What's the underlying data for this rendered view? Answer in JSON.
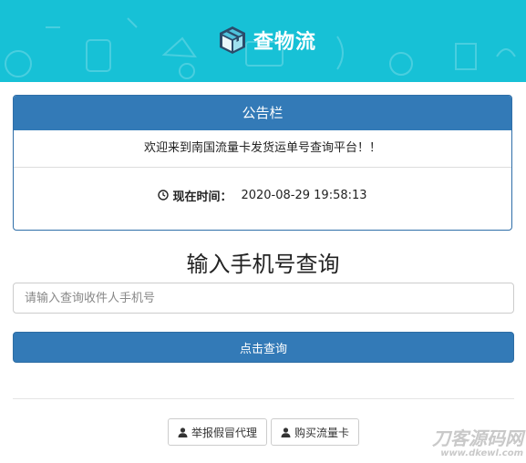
{
  "header": {
    "brand_text": "查物流",
    "background_color": "#17c1d6",
    "logo_icon": "package-box-icon"
  },
  "notice": {
    "title": "公告栏",
    "message": "欢迎来到南国流量卡发货运单号查询平台！！",
    "time_label": "现在时间：",
    "time_value": "2020-08-29 19:58:13",
    "time_icon": "clock-icon",
    "accent_color": "#337ab7"
  },
  "search": {
    "heading": "输入手机号查询",
    "placeholder": "请输入查询收件人手机号",
    "value": "",
    "button_label": "点击查询"
  },
  "footer": {
    "report_label": "举报假冒代理",
    "buy_label": "购买流量卡",
    "user_icon": "user-icon"
  },
  "watermark": {
    "line1": "刀客源码网",
    "line2": "www.dkewl.com"
  }
}
